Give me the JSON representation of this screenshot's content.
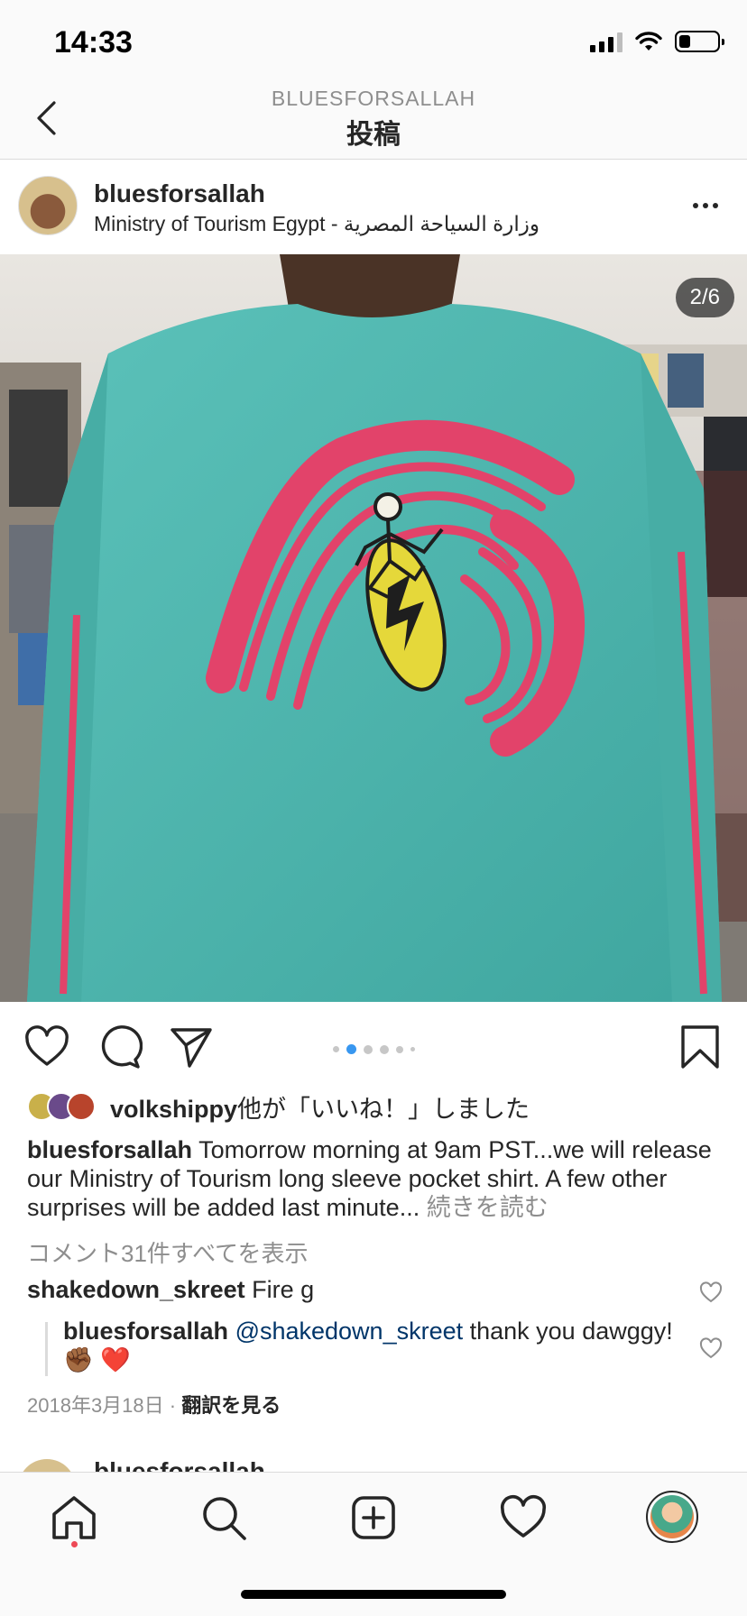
{
  "status_bar": {
    "time": "14:33",
    "icons": [
      "cellular-signal-icon",
      "wifi-icon",
      "battery-icon"
    ],
    "battery_level": 0.3
  },
  "nav": {
    "subtitle": "BLUESFORSALLAH",
    "title": "投稿",
    "back_icon": "chevron-left-icon"
  },
  "post": {
    "username": "bluesforsallah",
    "location": "Ministry of Tourism Egypt - وزارة السياحة المصرية",
    "more_icon": "more-horizontal-icon",
    "photo_counter": "2/6",
    "carousel_total": 6,
    "carousel_active": 2,
    "actions": {
      "like_icon": "heart-icon",
      "comment_icon": "comment-icon",
      "share_icon": "send-icon",
      "save_icon": "bookmark-icon"
    },
    "likes": {
      "user": "volkshippy",
      "suffix": "他が「いいね！」しました"
    },
    "caption": {
      "username": "bluesforsallah",
      "text": " Tomorrow morning at 9am PST...we will release our Ministry of Tourism long sleeve pocket shirt. A few other surprises will be added last minute...",
      "more_label": " 続きを読む"
    },
    "view_comments": "コメント31件すべてを表示",
    "comments": [
      {
        "username": "shakedown_skreet",
        "text": " Fire g"
      },
      {
        "username": "bluesforsallah",
        "mention": " @shakedown_skreet",
        "text": " thank you dawggy!✊🏾 ❤️"
      }
    ],
    "date": "2018年3月18日",
    "separator": " · ",
    "translate_label": "翻訳を見る"
  },
  "next_post": {
    "username": "bluesforsallah"
  },
  "tab_bar": {
    "items": [
      "home-icon",
      "search-icon",
      "add-post-icon",
      "activity-heart-icon",
      "profile-avatar"
    ]
  },
  "colors": {
    "shirt": "#4fb8b0",
    "print_pink": "#e2436a",
    "active_dot": "#3897f0",
    "notification_dot": "#ed4956"
  }
}
